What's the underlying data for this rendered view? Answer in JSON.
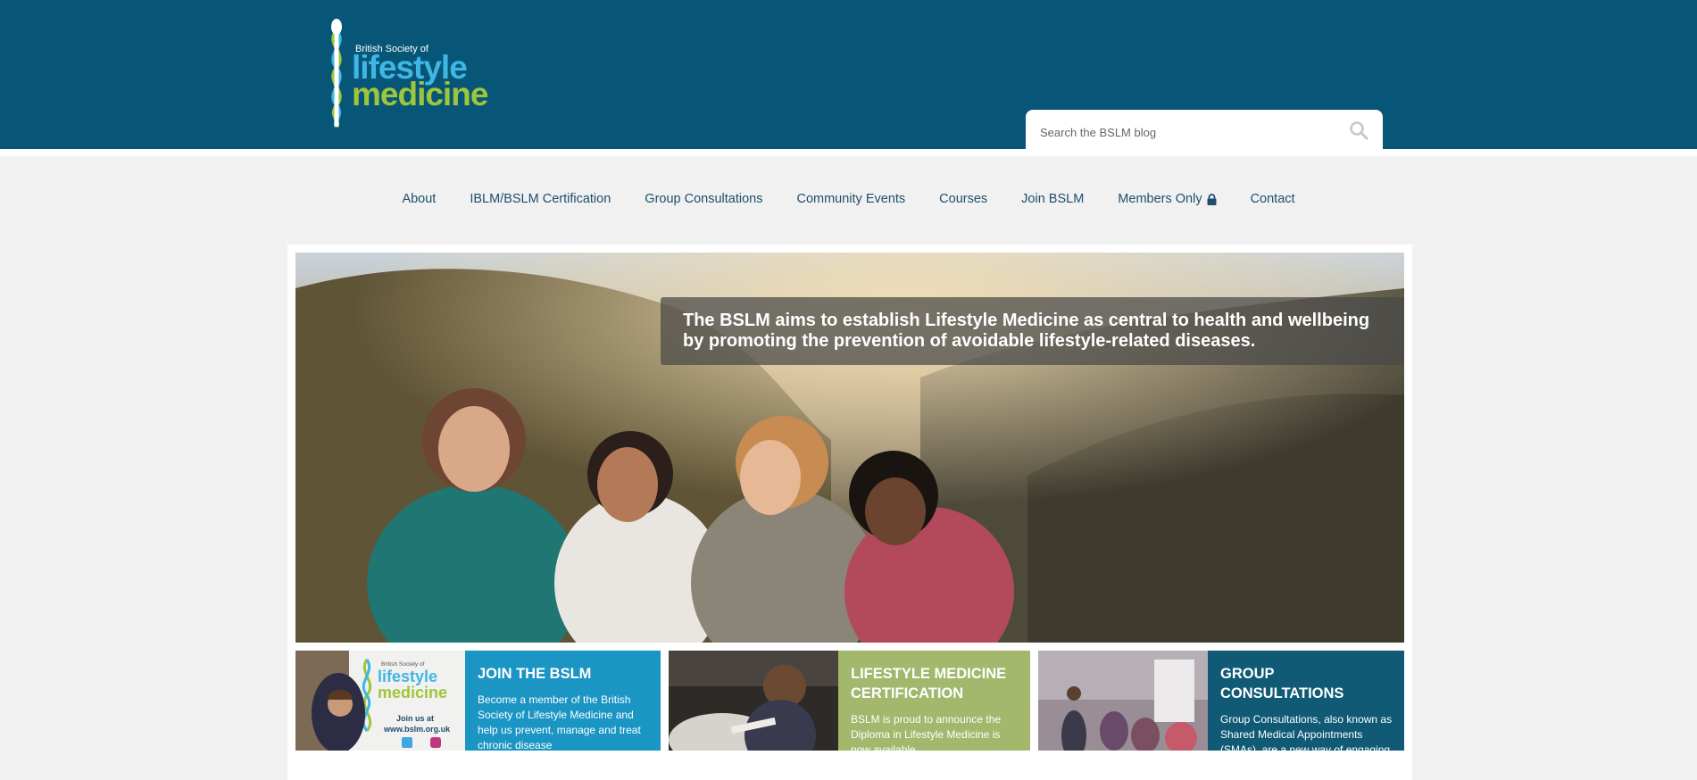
{
  "brand": {
    "line1": "British Society of",
    "line2": "lifestyle",
    "line3": "medicine",
    "colors": {
      "header": "#075677",
      "blue": "#3fb6e3",
      "green": "#9ec53b"
    }
  },
  "search": {
    "placeholder": "Search the BSLM blog",
    "icon": "search-icon"
  },
  "nav": {
    "items": [
      {
        "label": "About"
      },
      {
        "label": "IBLM/BSLM Certification"
      },
      {
        "label": "Group Consultations"
      },
      {
        "label": "Community Events"
      },
      {
        "label": "Courses"
      },
      {
        "label": "Join BSLM"
      },
      {
        "label": "Members Only",
        "icon": "lock-icon"
      },
      {
        "label": "Contact"
      }
    ]
  },
  "hero": {
    "caption": "The BSLM aims to establish Lifestyle Medicine as central to health and wellbeing by promoting the prevention of avoidable lifestyle-related diseases."
  },
  "cards": [
    {
      "title": "JOIN THE BSLM",
      "body": "Become a member of the British Society of Lifestyle Medicine and help us prevent, manage and treat chronic disease",
      "color": "#1a95c4",
      "image_text": {
        "line1": "British Society of",
        "line2": "lifestyle",
        "line3": "medicine",
        "join": "Join us at",
        "url": "www.bslm.org.uk"
      }
    },
    {
      "title": "LIFESTYLE MEDICINE CERTIFICATION",
      "body": "BSLM is proud to announce the Diploma in Lifestyle Medicine is now available",
      "color": "#a3b86c"
    },
    {
      "title": "GROUP CONSULTATIONS",
      "body": "Group Consultations, also known as Shared Medical Appointments (SMAs), are a new way of engaging",
      "color": "#105a76"
    }
  ]
}
